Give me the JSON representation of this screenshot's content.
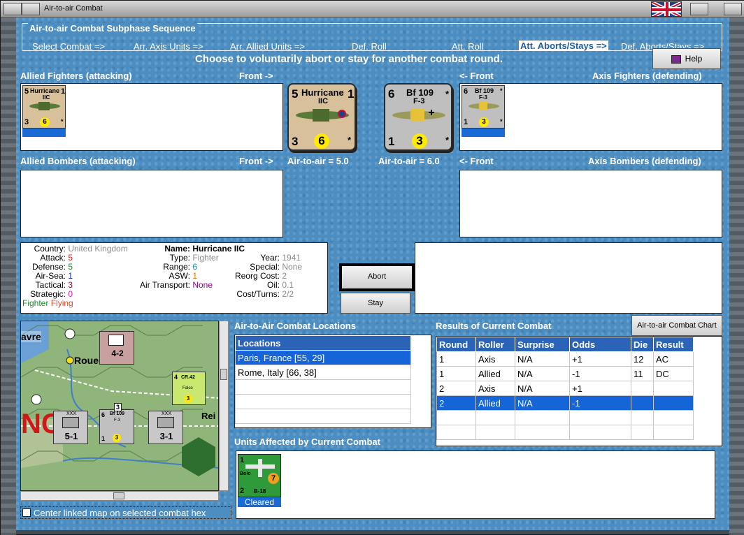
{
  "window": {
    "title": "Air-to-air Combat"
  },
  "sequence": {
    "title": "Air-to-air Combat Subphase Sequence",
    "steps": [
      "Select Combat =>",
      "Arr. Axis Units =>",
      "Arr. Allied Units =>",
      "Def. Roll",
      "Att. Roll",
      "Att. Aborts/Stays =>",
      "Def. Aborts/Stays =>"
    ],
    "active_step": "Att. Aborts/Stays =>"
  },
  "instruction": "Choose to voluntarily abort or stay for another combat round.",
  "help_label": "Help",
  "headers": {
    "allied_fighters": "Allied Fighters (attacking)",
    "front_right": "Front ->",
    "front_left": "<- Front",
    "axis_fighters": "Axis Fighters (defending)",
    "allied_bombers": "Allied Bombers (attacking)",
    "axis_bombers": "Axis Bombers (defending)",
    "locations": "Air-to-Air Combat Locations",
    "results": "Results of Current Combat",
    "affected": "Units Affected by Current Combat"
  },
  "allied_counter": {
    "attack": "5",
    "name": "Hurricane",
    "variant": "IIC",
    "defense": "1",
    "tactical": "3",
    "range": "6",
    "star": "*"
  },
  "axis_counter": {
    "attack": "6",
    "name": "Bf 109",
    "variant": "F-3",
    "defense": "*",
    "tactical": "1",
    "range": "3",
    "star": "*"
  },
  "air_to_air": {
    "allied": "Air-to-air = 5.0",
    "axis": "Air-to-air = 6.0"
  },
  "unit_info": {
    "country_label": "Country:",
    "country": "United Kingdom",
    "attack_label": "Attack:",
    "attack": "5",
    "defense_label": "Defense:",
    "defense": "5",
    "airsea_label": "Air-Sea:",
    "airsea": "1",
    "tactical_label": "Tactical:",
    "tactical": "3",
    "strategic_label": "Strategic:",
    "strategic": "0",
    "status1": "Fighter",
    "status2": "Flying",
    "name_label": "Name:",
    "name": "Hurricane IIC",
    "type_label": "Type:",
    "type": "Fighter",
    "range_label": "Range:",
    "range": "6",
    "asw_label": "ASW:",
    "asw": "1",
    "airtransport_label": "Air Transport:",
    "airtransport": "None",
    "year_label": "Year:",
    "year": "1941",
    "special_label": "Special:",
    "special": "None",
    "reorg_label": "Reorg Cost:",
    "reorg": "2",
    "oil_label": "Oil:",
    "oil": "0.1",
    "cost_label": "Cost/Turns:",
    "cost": "2/2"
  },
  "buttons": {
    "abort": "Abort",
    "stay": "Stay",
    "chart": "Air-to-air Combat Chart"
  },
  "map": {
    "labels": {
      "havre": "avre",
      "rouen": "Rouen",
      "reims": "Rei",
      "france": "NC"
    },
    "units": [
      {
        "top": "XXX",
        "value": "4-2",
        "side": "HQ"
      },
      {
        "top": "XXX",
        "value": "5-1",
        "side": "XXXVIII"
      },
      {
        "top": "XXX",
        "value": "3-1",
        "side": "XXXVII"
      },
      {
        "name": "CR.42",
        "sub": "Falco",
        "attack": "4",
        "range": "3"
      },
      {
        "name": "Bf 109",
        "sub": "F-3",
        "attack": "6",
        "defense": "1",
        "range": "3",
        "stack": "3"
      }
    ],
    "checkbox_label": "Center linked map on selected combat hex"
  },
  "locations": {
    "header": "Locations",
    "rows": [
      "Paris, France [55, 29]",
      "Rome, Italy [66, 38]"
    ],
    "selected": 0
  },
  "results": {
    "headers": [
      "Round",
      "Roller",
      "Surprise",
      "Odds",
      "Die",
      "Result"
    ],
    "rows": [
      [
        "1",
        "Axis",
        "N/A",
        "+1",
        "12",
        "AC"
      ],
      [
        "1",
        "Allied",
        "N/A",
        "-1",
        "11",
        "DC"
      ],
      [
        "2",
        "Axis",
        "N/A",
        "+1",
        "",
        ""
      ],
      [
        "2",
        "Allied",
        "N/A",
        "-1",
        "",
        ""
      ]
    ],
    "selected": 3
  },
  "affected_unit": {
    "attack": "1",
    "name": "Bolo",
    "model": "B-18",
    "defense": "2",
    "range": "7",
    "status": "Cleared"
  },
  "colors": {
    "water": "#4c8ec2",
    "selected": "#1565d8",
    "header": "#2a63b8",
    "red": "#d11f1f",
    "green": "#1a8a2e",
    "blue": "#1a2fbf",
    "gray": "#8a8a8a",
    "purple": "#8a0a8a"
  }
}
